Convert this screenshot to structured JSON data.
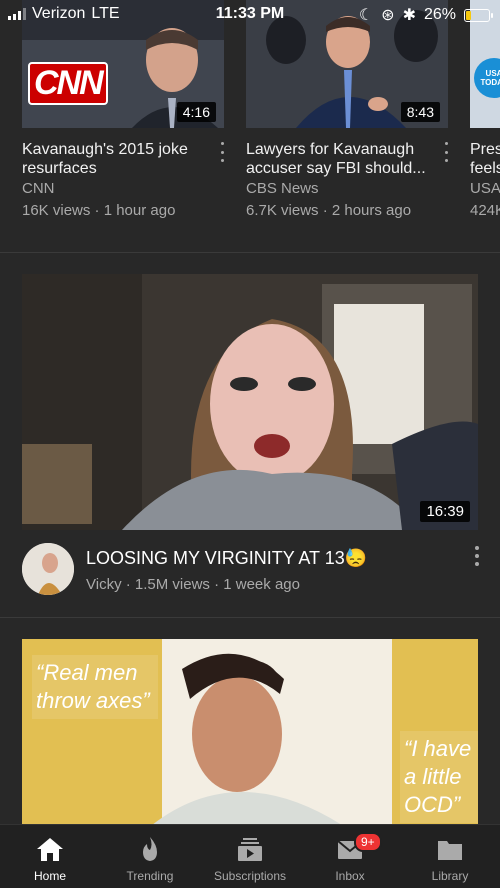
{
  "status_bar": {
    "carrier": "Verizon",
    "network": "LTE",
    "time": "11:33 PM",
    "battery_pct": "26%",
    "battery_level": 0.26
  },
  "shelf": {
    "items": [
      {
        "title": "Kavanaugh's 2015 joke resurfaces",
        "channel": "CNN",
        "meta": "16K views · 1 hour ago",
        "duration": "4:16",
        "logo": "CNN"
      },
      {
        "title": "Lawyers for Kavanaugh accuser say FBI should...",
        "channel": "CBS News",
        "meta": "6.7K views · 2 hours ago",
        "duration": "8:43"
      },
      {
        "title": "Pres feels",
        "channel": "USA",
        "meta": "424K",
        "logo": "USA TODAY"
      }
    ]
  },
  "feed": {
    "video1": {
      "title": "LOOSING MY VIRGINITY AT 13😓",
      "meta": "Vicky · 1.5M views · 1 week ago",
      "duration": "16:39"
    },
    "video2": {
      "overlay_left": "“Real men throw axes”",
      "overlay_right": "“I have a little OCD”"
    }
  },
  "bottom_nav": {
    "tabs": [
      {
        "label": "Home",
        "icon": "home-icon"
      },
      {
        "label": "Trending",
        "icon": "trending-icon"
      },
      {
        "label": "Subscriptions",
        "icon": "subscriptions-icon"
      },
      {
        "label": "Inbox",
        "icon": "inbox-icon",
        "badge": "9+"
      },
      {
        "label": "Library",
        "icon": "library-icon"
      }
    ]
  },
  "colors": {
    "background": "#282828",
    "accent_badge": "#e33",
    "battery": "#f6c90e"
  }
}
